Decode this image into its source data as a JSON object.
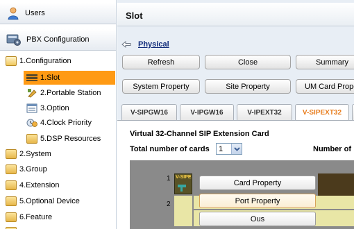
{
  "sidebar": {
    "users_label": "Users",
    "pbx_label": "PBX Configuration",
    "tree": [
      {
        "label": "1.Configuration",
        "icon": "folder-open-icon"
      },
      {
        "label": "1.Slot",
        "icon": "slot-icon",
        "selected": true
      },
      {
        "label": "2.Portable Station",
        "icon": "portable-station-icon"
      },
      {
        "label": "3.Option",
        "icon": "option-icon"
      },
      {
        "label": "4.Clock Priority",
        "icon": "clock-priority-icon"
      },
      {
        "label": "5.DSP Resources",
        "icon": "folder-icon"
      },
      {
        "label": "2.System",
        "icon": "folder-icon"
      },
      {
        "label": "3.Group",
        "icon": "folder-icon"
      },
      {
        "label": "4.Extension",
        "icon": "folder-icon"
      },
      {
        "label": "5.Optional Device",
        "icon": "folder-icon"
      },
      {
        "label": "6.Feature",
        "icon": "folder-icon"
      }
    ]
  },
  "header": {
    "title": "Slot"
  },
  "breadcrumb": {
    "link": "Physical"
  },
  "toolbar": {
    "refresh": "Refresh",
    "close": "Close",
    "summary": "Summary",
    "system_property": "System Property",
    "site_property": "Site Property",
    "um_card_property": "UM Card Prope"
  },
  "tabs": [
    {
      "label": "V-SIPGW16",
      "active": false
    },
    {
      "label": "V-IPGW16",
      "active": false
    },
    {
      "label": "V-IPEXT32",
      "active": false
    },
    {
      "label": "V-SIPEXT32",
      "active": true
    }
  ],
  "content": {
    "card_title": "Virtual 32-Channel SIP Extension Card",
    "total_label": "Total number of cards",
    "total_value": "1",
    "number_label": "Number of"
  },
  "shelf": {
    "slot_numbers": [
      "1",
      "2"
    ],
    "card_label": "V-SIPE",
    "menu": [
      "Card Property",
      "Port Property",
      "Ous"
    ]
  },
  "colors": {
    "selected": "#ff9a14",
    "active_tab": "#e87d1e",
    "link": "#102b7a",
    "main_bg": "#e8eef5"
  }
}
